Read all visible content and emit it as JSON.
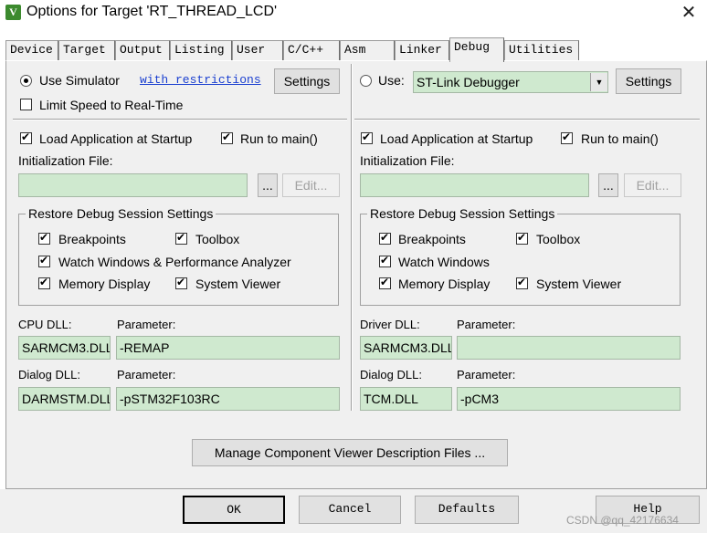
{
  "window": {
    "title": "Options for Target 'RT_THREAD_LCD'",
    "app_icon_glyph": "V",
    "close_glyph": "✕"
  },
  "tabs": [
    {
      "label": "Device"
    },
    {
      "label": "Target"
    },
    {
      "label": "Output"
    },
    {
      "label": "Listing"
    },
    {
      "label": "User"
    },
    {
      "label": "C/C++"
    },
    {
      "label": "Asm"
    },
    {
      "label": "Linker"
    },
    {
      "label": "Debug",
      "active": true
    },
    {
      "label": "Utilities"
    }
  ],
  "left": {
    "use_simulator_label": "Use Simulator",
    "use_simulator_selected": true,
    "with_restrictions_link": "with restrictions",
    "settings_button": "Settings",
    "limit_speed_label": "Limit Speed to Real-Time",
    "limit_speed_checked": false,
    "load_app_label": "Load Application at Startup",
    "load_app_checked": true,
    "run_to_main_label": "Run to main()",
    "run_to_main_checked": true,
    "init_file_label": "Initialization File:",
    "init_file_value": "",
    "browse_button": "...",
    "edit_button": "Edit...",
    "restore_group_title": "Restore Debug Session Settings",
    "breakpoints_label": "Breakpoints",
    "toolbox_label": "Toolbox",
    "watch_label": "Watch Windows & Performance Analyzer",
    "memory_label": "Memory Display",
    "system_viewer_label": "System Viewer",
    "cpu_dll_label": "CPU DLL:",
    "cpu_param_label": "Parameter:",
    "cpu_dll_value": "SARMCM3.DLL",
    "cpu_param_value": "-REMAP",
    "dialog_dll_label": "Dialog DLL:",
    "dialog_param_label": "Parameter:",
    "dialog_dll_value": "DARMSTM.DLL",
    "dialog_param_value": "-pSTM32F103RC"
  },
  "right": {
    "use_label": "Use:",
    "use_selected": false,
    "debugger_value": "ST-Link Debugger",
    "settings_button": "Settings",
    "load_app_label": "Load Application at Startup",
    "load_app_checked": true,
    "run_to_main_label": "Run to main()",
    "run_to_main_checked": true,
    "init_file_label": "Initialization File:",
    "init_file_value": "",
    "browse_button": "...",
    "edit_button": "Edit...",
    "restore_group_title": "Restore Debug Session Settings",
    "breakpoints_label": "Breakpoints",
    "toolbox_label": "Toolbox",
    "watch_label": "Watch Windows",
    "memory_label": "Memory Display",
    "system_viewer_label": "System Viewer",
    "driver_dll_label": "Driver DLL:",
    "driver_param_label": "Parameter:",
    "driver_dll_value": "SARMCM3.DLL",
    "driver_param_value": "",
    "dialog_dll_label": "Dialog DLL:",
    "dialog_param_label": "Parameter:",
    "dialog_dll_value": "TCM.DLL",
    "dialog_param_value": "-pCM3"
  },
  "manage_button": "Manage Component Viewer Description Files ...",
  "footer": {
    "ok": "OK",
    "cancel": "Cancel",
    "defaults": "Defaults",
    "help": "Help"
  },
  "watermark": "CSDN @qq_42176634",
  "colors": {
    "field_green": "#cfe9cf",
    "link_blue": "#1a3fd0",
    "panel_gray": "#f0f0f0"
  }
}
